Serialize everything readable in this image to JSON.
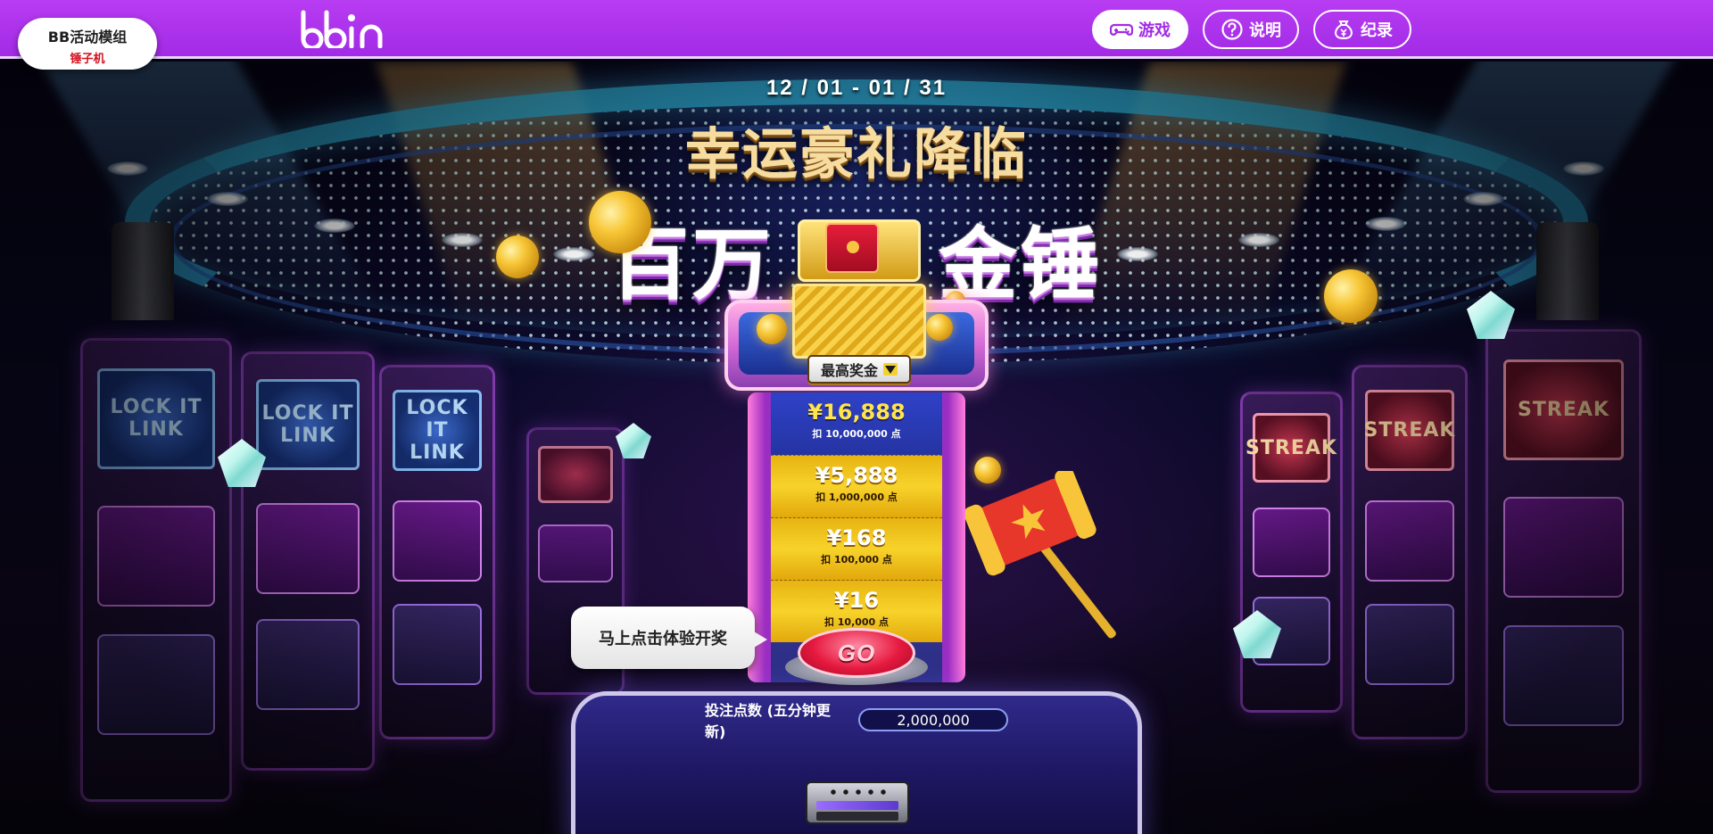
{
  "header": {
    "module_badge": {
      "title": "BB活动模组",
      "subtitle": "锤子机"
    },
    "brand_logo": "bbin",
    "nav": [
      {
        "label": "游戏",
        "icon": "gamepad-icon",
        "active": true
      },
      {
        "label": "说明",
        "icon": "question-icon",
        "active": false
      },
      {
        "label": "纪录",
        "icon": "money-bag-icon",
        "active": false
      }
    ],
    "colors": {
      "bar": "#a22be6",
      "accent": "#b83cf2"
    }
  },
  "event": {
    "date_range": "12 / 01 - 01 / 31",
    "headline": "幸运豪礼降临",
    "title_left": "百万",
    "title_right": "金锤"
  },
  "prize_machine": {
    "max_prize_label": "最高奖金",
    "tiers": [
      {
        "amount": "¥16,888",
        "cost": "扣 10,000,000 点"
      },
      {
        "amount": "¥5,888",
        "cost": "扣 1,000,000 点"
      },
      {
        "amount": "¥168",
        "cost": "扣 100,000 点"
      },
      {
        "amount": "¥16",
        "cost": "扣 10,000 点"
      }
    ],
    "go_button": "GO",
    "tooltip": "马上点击体验开奖"
  },
  "console": {
    "bet_label": "投注点数 (五分钟更新)",
    "bet_value": "2,000,000"
  }
}
